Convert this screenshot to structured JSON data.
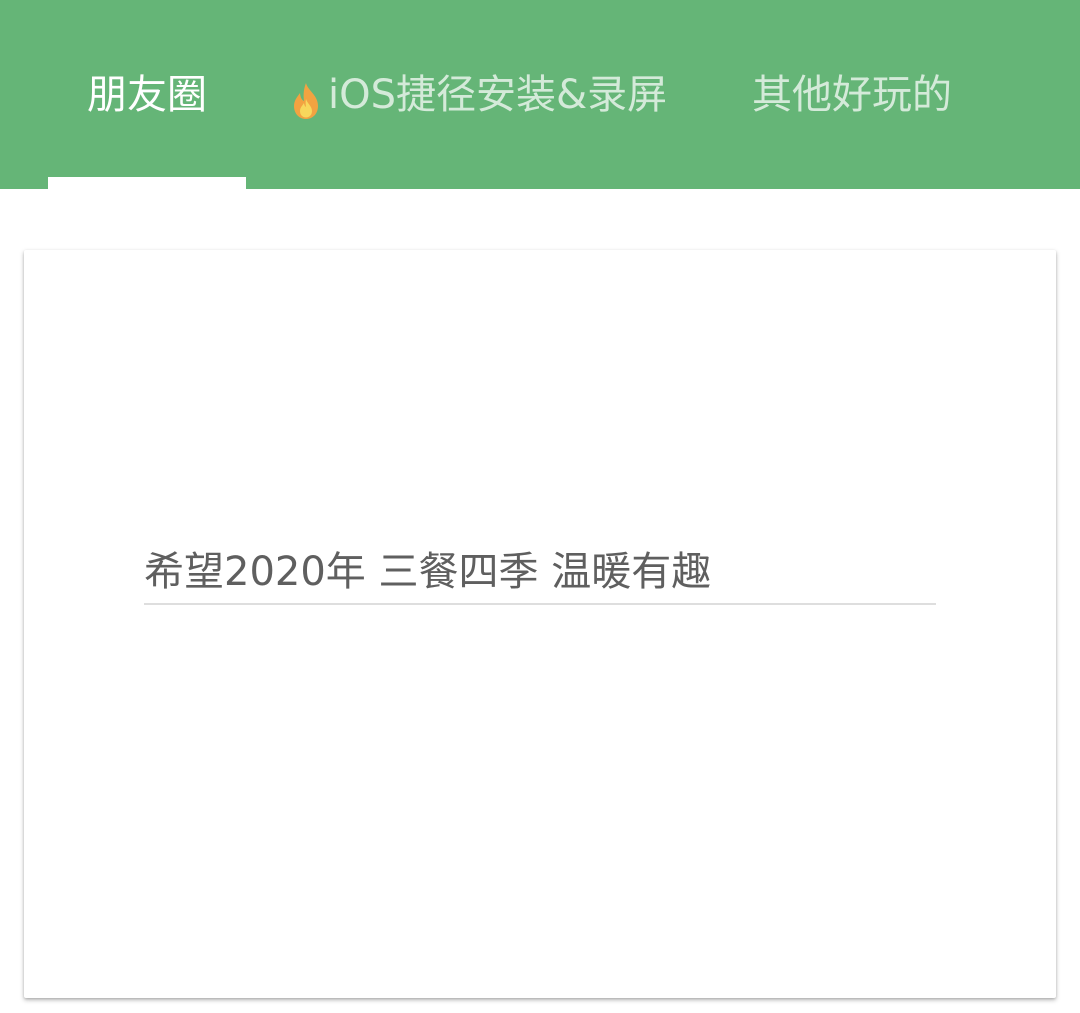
{
  "tabs": [
    {
      "label": "朋友圈",
      "active": true
    },
    {
      "label": "iOS捷径安装&录屏",
      "active": false,
      "icon": "fire-icon"
    },
    {
      "label": "其他好玩的",
      "active": false
    }
  ],
  "main": {
    "input_value": "希望2020年 三餐四季 温暖有趣"
  },
  "colors": {
    "accent": "#65b577",
    "indicator": "#ffffff",
    "input_text": "#5f5f5f",
    "underline": "#dedede"
  }
}
